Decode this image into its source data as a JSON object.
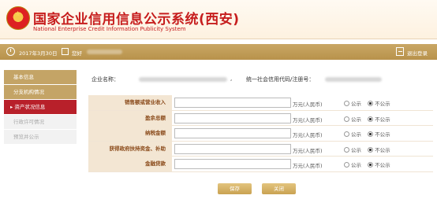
{
  "header": {
    "title_cn": "国家企业信用信息公示系统(西安)",
    "title_en": "National Enterprise Credit Information Publicity System"
  },
  "topbar": {
    "date": "2017年3月30日",
    "user_label": "您好",
    "logout_label": "退出登录"
  },
  "sidebar": {
    "items": [
      {
        "label": "基本信息"
      },
      {
        "label": "分支机构情况"
      },
      {
        "label": "资产状况信息"
      },
      {
        "label": "行政许可情况"
      },
      {
        "label": "预览并公示"
      }
    ]
  },
  "company": {
    "name_label": "企业名称：",
    "separator": ",",
    "code_label": "统一社会信用代码/注册号："
  },
  "form": {
    "rows": [
      {
        "label": "销售额或营业收入",
        "value": "",
        "unit": "万元(人民币)",
        "public": "公示",
        "private": "不公示",
        "selected": "不公示"
      },
      {
        "label": "盈余总额",
        "value": "",
        "unit": "万元(人民币)",
        "public": "公示",
        "private": "不公示",
        "selected": "不公示"
      },
      {
        "label": "纳税金额",
        "value": "",
        "unit": "万元(人民币)",
        "public": "公示",
        "private": "不公示",
        "selected": "不公示"
      },
      {
        "label": "获得政府扶持资金、补助",
        "value": "",
        "unit": "万元(人民币)",
        "public": "公示",
        "private": "不公示",
        "selected": "不公示"
      },
      {
        "label": "金融贷款",
        "value": "",
        "unit": "万元(人民币)",
        "public": "公示",
        "private": "不公示",
        "selected": "不公示"
      }
    ]
  },
  "buttons": {
    "save": "保存",
    "close": "关闭"
  },
  "colors": {
    "brand_red": "#c61d1d",
    "gold": "#c4a466",
    "active_red": "#b8202a"
  }
}
